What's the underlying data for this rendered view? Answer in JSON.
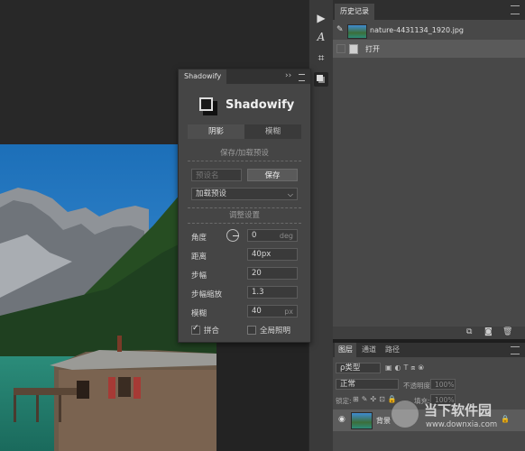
{
  "history": {
    "tab_label": "历史记录",
    "snapshot_name": "nature-4431134_1920.jpg",
    "step_label": "打开"
  },
  "layers": {
    "tabs": [
      "图层",
      "通道",
      "路径"
    ],
    "filter_label": "ρ类型",
    "blend_mode": "正常",
    "opacity_label": "不透明度:",
    "opacity_value": "100%",
    "lock_label": "锁定:",
    "fill_label": "填充:",
    "fill_value": "100%",
    "layer_name": "背景"
  },
  "shadowify": {
    "panel_tab": "Shadowify",
    "menu_glyph": "››",
    "title": "Shadowify",
    "tabs": [
      "阴影",
      "模糊"
    ],
    "preset_section": "保存/加载预设",
    "preset_name_placeholder": "预设名",
    "save_button": "保存",
    "load_preset": "加载预设",
    "adjust_section": "调整设置",
    "angle_label": "角度",
    "angle_value": "0",
    "angle_unit": "deg",
    "distance_label": "距离",
    "distance_value": "40px",
    "steps_label": "步幅",
    "steps_value": "20",
    "step_scale_label": "步幅缩放",
    "step_scale_value": "1.3",
    "blur_label": "模糊",
    "blur_value": "40",
    "blur_unit": "px",
    "merge_label": "拼合",
    "merge_checked": true,
    "global_light_label": "全局照明",
    "global_light_checked": false
  },
  "watermark": {
    "name": "当下软件园",
    "url": "www.downxia.com"
  },
  "colors": {
    "panel_bg": "#484848",
    "dark_bg": "#262626",
    "accent_button": "#5a5a5a"
  }
}
